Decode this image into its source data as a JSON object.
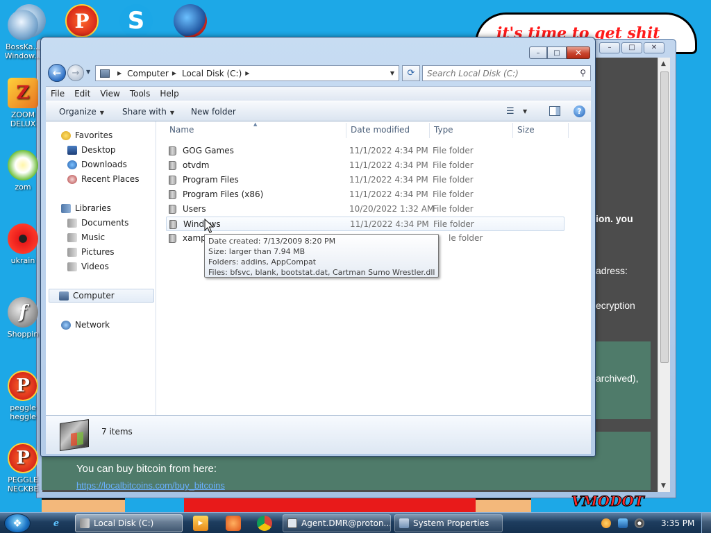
{
  "desktop": {
    "icons": [
      {
        "label": "BossKa... Window...",
        "icon": "bowl-icon"
      },
      {
        "label": "ZOOM DELUX",
        "icon": "zoom-icon"
      },
      {
        "label": "zom",
        "icon": "flower-icon"
      },
      {
        "label": "ukrain",
        "icon": "radiation-icon"
      },
      {
        "label": "Shoppin",
        "icon": "flash-icon"
      },
      {
        "label": "peggle heggle",
        "icon": "peggle-icon"
      },
      {
        "label": "PEGGLE NECKBE",
        "icon": "peggle-icon"
      }
    ],
    "top_icons": [
      {
        "icon": "bowl-icon",
        "glyph": ""
      },
      {
        "icon": "popcap-icon",
        "glyph": "P"
      },
      {
        "icon": "skype-icon",
        "glyph": "S"
      },
      {
        "icon": "world-icon",
        "glyph": ""
      }
    ],
    "banner_text": "it's time to get shit",
    "back_window": {
      "fragments": [
        "ion. you",
        "adress:",
        "ecryption",
        "archived),"
      ],
      "bitcoin_text": "You can buy bitcoin from here:",
      "bitcoin_link": "https://localbitcoins.com/buy_bitcoins"
    },
    "corner_text": "VMODOT"
  },
  "explorer": {
    "title": "Local Disk (C:)",
    "window_buttons": {
      "minimize": "–",
      "maximize": "□",
      "close": "✕"
    },
    "breadcrumb": [
      "Computer",
      "Local Disk (C:)"
    ],
    "search_placeholder": "Search Local Disk (C:)",
    "menu": [
      "File",
      "Edit",
      "View",
      "Tools",
      "Help"
    ],
    "commands": {
      "organize": "Organize",
      "share": "Share with",
      "new_folder": "New folder",
      "help": "?"
    },
    "nav": {
      "favorites": "Favorites",
      "desktop": "Desktop",
      "downloads": "Downloads",
      "recent": "Recent Places",
      "libraries": "Libraries",
      "documents": "Documents",
      "music": "Music",
      "pictures": "Pictures",
      "videos": "Videos",
      "computer": "Computer",
      "network": "Network"
    },
    "columns": {
      "name": "Name",
      "date": "Date modified",
      "type": "Type",
      "size": "Size"
    },
    "files": [
      {
        "name": "GOG Games",
        "date": "11/1/2022 4:34 PM",
        "type": "File folder"
      },
      {
        "name": "otvdm",
        "date": "11/1/2022 4:34 PM",
        "type": "File folder"
      },
      {
        "name": "Program Files",
        "date": "11/1/2022 4:34 PM",
        "type": "File folder"
      },
      {
        "name": "Program Files (x86)",
        "date": "11/1/2022 4:34 PM",
        "type": "File folder"
      },
      {
        "name": "Users",
        "date": "10/20/2022 1:32 AM",
        "type": "File folder"
      },
      {
        "name": "Windows",
        "date": "11/1/2022 4:34 PM",
        "type": "File folder"
      },
      {
        "name": "xamp",
        "date": "",
        "type": "le folder"
      }
    ],
    "tooltip": {
      "created": "Date created: 7/13/2009 8:20 PM",
      "size": "Size: larger than 7.94 MB",
      "folders": "Folders: addins, AppCompat",
      "files": "Files: bfsvc, blank, bootstat.dat, Cartman Sumo Wrestler.dll, ..."
    },
    "status": {
      "item_count": "7 items"
    }
  },
  "taskbar": {
    "start_glyph": "❖",
    "tasks": [
      {
        "label": "Local Disk (C:)",
        "icon_color": "#a7b8c8",
        "active": true
      },
      {
        "label": "Agent.DMR@proton...",
        "icon_color": "#dfe6ee",
        "active": false
      },
      {
        "label": "System Properties",
        "icon_color": "#c9d6e6",
        "active": false
      }
    ],
    "clock": "3:35 PM"
  },
  "colors": {
    "desktop": "#1da8e7",
    "close_button": "#c9442d",
    "accent": "#2c6fc4"
  }
}
